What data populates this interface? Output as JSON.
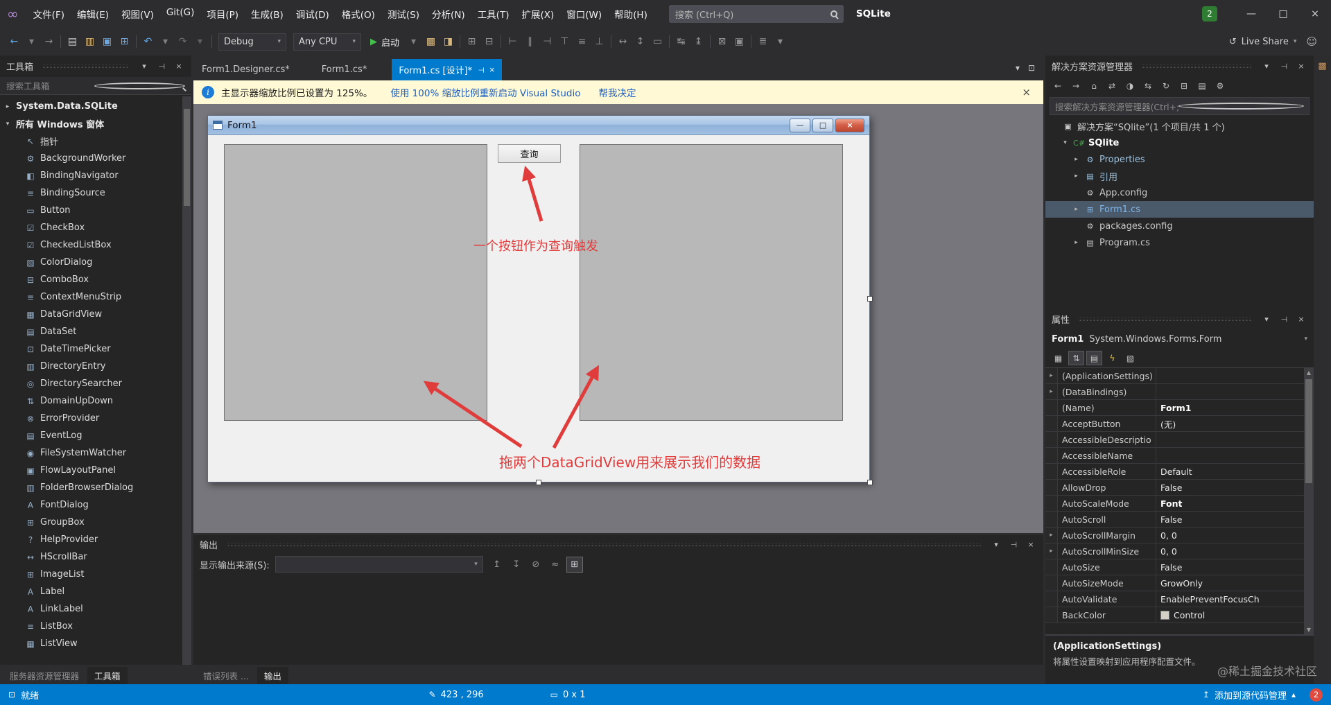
{
  "icons": {
    "caret": "▾",
    "pin": "⊤",
    "close": "×",
    "small_caret": "▴"
  },
  "window": {
    "logo": "∞",
    "badge": "2",
    "solution_title": "SQLite",
    "minimize": "—",
    "maximize": "□",
    "close": "×"
  },
  "menubar": [
    "文件(F)",
    "编辑(E)",
    "视图(V)",
    "Git(G)",
    "项目(P)",
    "生成(B)",
    "调试(D)",
    "格式(O)",
    "测试(S)",
    "分析(N)",
    "工具(T)",
    "扩展(X)",
    "窗口(W)",
    "帮助(H)"
  ],
  "search": {
    "placeholder": "搜索 (Ctrl+Q)"
  },
  "toolbar": {
    "left_icons": [
      {
        "name": "back-icon",
        "glyph": "←",
        "color": "#5fa8ea"
      },
      {
        "name": "back-caret-icon",
        "glyph": "▾",
        "color": "#7f7f7f"
      },
      {
        "name": "forward-icon",
        "glyph": "→",
        "color": "#8b8b8b"
      },
      {
        "name": "toolbar-separator",
        "glyph": "",
        "sep": true
      },
      {
        "name": "new-file-icon",
        "glyph": "▤",
        "color": "#c9c9c9"
      },
      {
        "name": "open-folder-icon",
        "glyph": "▥",
        "color": "#d9b97c"
      },
      {
        "name": "save-icon",
        "glyph": "▣",
        "color": "#6ea8e0"
      },
      {
        "name": "save-all-icon",
        "glyph": "⊞",
        "color": "#6ea8e0"
      },
      {
        "name": "toolbar-separator",
        "glyph": "",
        "sep": true
      },
      {
        "name": "undo-icon",
        "glyph": "↶",
        "color": "#5fa8ea"
      },
      {
        "name": "undo-caret-icon",
        "glyph": "▾",
        "color": "#7f7f7f"
      },
      {
        "name": "redo-icon",
        "glyph": "↷",
        "color": "#6f6f6f"
      },
      {
        "name": "redo-caret-icon",
        "glyph": "▾",
        "color": "#5f5f5f"
      },
      {
        "name": "toolbar-separator",
        "glyph": "",
        "sep": true
      }
    ],
    "debug_target": "Debug",
    "platform": "Any CPU",
    "start_label": "启动",
    "play_glyph": "▶",
    "right_icons": [
      {
        "name": "start-caret-icon",
        "glyph": "▾",
        "color": "#7f7f7f"
      },
      {
        "name": "attach-icon",
        "glyph": "▩",
        "color": "#d9b97c"
      },
      {
        "name": "screenshot-icon",
        "glyph": "◨",
        "color": "#d9b97c"
      },
      {
        "name": "toolbar-separator",
        "glyph": "",
        "sep": true
      },
      {
        "name": "show-grid-icon",
        "glyph": "⊞",
        "color": "#8f8f8f"
      },
      {
        "name": "align-to-grid-icon",
        "glyph": "⊟",
        "color": "#8f8f8f"
      },
      {
        "name": "toolbar-separator",
        "glyph": "",
        "sep": true
      },
      {
        "name": "align-lefts-icon",
        "glyph": "⊢",
        "color": "#8f8f8f"
      },
      {
        "name": "align-centers-icon",
        "glyph": "∥",
        "color": "#8f8f8f"
      },
      {
        "name": "align-rights-icon",
        "glyph": "⊣",
        "color": "#8f8f8f"
      },
      {
        "name": "align-tops-icon",
        "glyph": "⊤",
        "color": "#8f8f8f"
      },
      {
        "name": "align-middles-icon",
        "glyph": "≡",
        "color": "#8f8f8f"
      },
      {
        "name": "align-bottoms-icon",
        "glyph": "⊥",
        "color": "#8f8f8f"
      },
      {
        "name": "toolbar-separator",
        "glyph": "",
        "sep": true
      },
      {
        "name": "same-width-icon",
        "glyph": "↔",
        "color": "#8f8f8f"
      },
      {
        "name": "same-height-icon",
        "glyph": "↕",
        "color": "#8f8f8f"
      },
      {
        "name": "same-size-icon",
        "glyph": "▭",
        "color": "#8f8f8f"
      },
      {
        "name": "toolbar-separator",
        "glyph": "",
        "sep": true
      },
      {
        "name": "horizontal-spacing-icon",
        "glyph": "↹",
        "color": "#8f8f8f"
      },
      {
        "name": "vertical-spacing-icon",
        "glyph": "↨",
        "color": "#8f8f8f"
      },
      {
        "name": "toolbar-separator",
        "glyph": "",
        "sep": true
      },
      {
        "name": "bring-to-front-icon",
        "glyph": "⊠",
        "color": "#8f8f8f"
      },
      {
        "name": "send-to-back-icon",
        "glyph": "▣",
        "color": "#8f8f8f"
      },
      {
        "name": "toolbar-separator",
        "glyph": "",
        "sep": true
      },
      {
        "name": "tab-order-icon",
        "glyph": "≣",
        "color": "#8f8f8f"
      },
      {
        "name": "toolbar-options-icon",
        "glyph": "▾",
        "color": "#8f8f8f"
      }
    ],
    "live_share": {
      "label": "Live Share",
      "glyph": "↺"
    },
    "feedback_glyph": "☺"
  },
  "toolbox": {
    "title": "工具箱",
    "search_placeholder": "搜索工具箱",
    "rows": [
      {
        "label": "System.Data.SQLite",
        "exp": "▸",
        "group": true
      },
      {
        "label": "所有 Windows 窗体",
        "exp": "▾",
        "group": true
      },
      {
        "label": "指针",
        "glyph": "↖",
        "exp": ""
      },
      {
        "label": "BackgroundWorker",
        "glyph": "⚙",
        "exp": ""
      },
      {
        "label": "BindingNavigator",
        "glyph": "◧",
        "exp": ""
      },
      {
        "label": "BindingSource",
        "glyph": "≡",
        "exp": ""
      },
      {
        "label": "Button",
        "glyph": "▭",
        "exp": ""
      },
      {
        "label": "CheckBox",
        "glyph": "☑",
        "exp": ""
      },
      {
        "label": "CheckedListBox",
        "glyph": "☑",
        "exp": ""
      },
      {
        "label": "ColorDialog",
        "glyph": "▨",
        "exp": ""
      },
      {
        "label": "ComboBox",
        "glyph": "⊟",
        "exp": ""
      },
      {
        "label": "ContextMenuStrip",
        "glyph": "≡",
        "exp": ""
      },
      {
        "label": "DataGridView",
        "glyph": "▦",
        "exp": ""
      },
      {
        "label": "DataSet",
        "glyph": "▤",
        "exp": ""
      },
      {
        "label": "DateTimePicker",
        "glyph": "⊡",
        "exp": ""
      },
      {
        "label": "DirectoryEntry",
        "glyph": "▥",
        "exp": ""
      },
      {
        "label": "DirectorySearcher",
        "glyph": "◎",
        "exp": ""
      },
      {
        "label": "DomainUpDown",
        "glyph": "⇅",
        "exp": ""
      },
      {
        "label": "ErrorProvider",
        "glyph": "⊗",
        "exp": ""
      },
      {
        "label": "EventLog",
        "glyph": "▤",
        "exp": ""
      },
      {
        "label": "FileSystemWatcher",
        "glyph": "◉",
        "exp": ""
      },
      {
        "label": "FlowLayoutPanel",
        "glyph": "▣",
        "exp": ""
      },
      {
        "label": "FolderBrowserDialog",
        "glyph": "▥",
        "exp": ""
      },
      {
        "label": "FontDialog",
        "glyph": "A",
        "exp": ""
      },
      {
        "label": "GroupBox",
        "glyph": "⊞",
        "exp": ""
      },
      {
        "label": "HelpProvider",
        "glyph": "?",
        "exp": ""
      },
      {
        "label": "HScrollBar",
        "glyph": "↔",
        "exp": ""
      },
      {
        "label": "ImageList",
        "glyph": "⊞",
        "exp": ""
      },
      {
        "label": "Label",
        "glyph": "A",
        "exp": ""
      },
      {
        "label": "LinkLabel",
        "glyph": "A",
        "exp": ""
      },
      {
        "label": "ListBox",
        "glyph": "≡",
        "exp": ""
      },
      {
        "label": "ListView",
        "glyph": "▦",
        "exp": ""
      }
    ],
    "bottom_tabs": [
      {
        "label": "服务器资源管理器"
      },
      {
        "label": "工具箱",
        "active": true
      }
    ]
  },
  "editor": {
    "tabs": [
      {
        "label": "Form1.Designer.cs*"
      },
      {
        "label": "Form1.cs*"
      },
      {
        "label": "Form1.cs [设计]*",
        "active": true
      }
    ],
    "tabstrip_icons": [
      {
        "name": "active-files-caret-icon",
        "glyph": "▾"
      },
      {
        "name": "window-layout-icon",
        "glyph": "⊡"
      }
    ],
    "infobar": {
      "message": "主显示器缩放比例已设置为 125%。",
      "link1": "使用 100% 缩放比例重新启动 Visual Studio",
      "link2": "帮我决定"
    },
    "form": {
      "title": "Form1",
      "query_button": "查询",
      "annotation_button": "一个按钮作为查询触发",
      "annotation_grids": "拖两个DataGridView用来展示我们的数据"
    }
  },
  "output": {
    "title": "输出",
    "source_label": "显示输出来源(S):",
    "source_value": "",
    "icons": [
      {
        "name": "jump-previous-icon",
        "glyph": "↥"
      },
      {
        "name": "jump-next-icon",
        "glyph": "↧"
      },
      {
        "name": "clear-all-icon",
        "glyph": "⊘"
      },
      {
        "name": "word-wrap-icon",
        "glyph": "≈"
      },
      {
        "name": "auto-scroll-icon",
        "glyph": "⊞",
        "boxed": true
      }
    ],
    "bottom_tabs": [
      {
        "label": "错误列表 ..."
      },
      {
        "label": "输出",
        "active": true
      }
    ]
  },
  "solution_explorer": {
    "title": "解决方案资源管理器",
    "search_placeholder": "搜索解决方案资源管理器(Ctrl+;)",
    "toolbar_icons": [
      {
        "name": "back-icon",
        "glyph": "←"
      },
      {
        "name": "forward-icon",
        "glyph": "→"
      },
      {
        "name": "home-icon",
        "glyph": "⌂"
      },
      {
        "name": "switch-views-icon",
        "glyph": "⇄"
      },
      {
        "name": "pending-changes-icon",
        "glyph": "◑"
      },
      {
        "name": "sync-active-document-icon",
        "glyph": "⇆"
      },
      {
        "name": "refresh-icon",
        "glyph": "↻"
      },
      {
        "name": "collapse-all-icon",
        "glyph": "⊟"
      },
      {
        "name": "show-all-files-icon",
        "glyph": "▤"
      },
      {
        "name": "properties-icon",
        "glyph": "⚙"
      }
    ],
    "tree": [
      {
        "label": "解决方案“SQlite”(1 个项目/共 1 个)",
        "glyph": "▣",
        "color": "#c8c8c8",
        "indent": 0,
        "exp": ""
      },
      {
        "label": "SQlite",
        "glyph": "C#",
        "color": "#46a84c",
        "indent": 1,
        "exp": "▾",
        "bold": true
      },
      {
        "label": "Properties",
        "glyph": "⚙",
        "color": "#9cc3e0",
        "indent": 2,
        "exp": "▸"
      },
      {
        "label": "引用",
        "glyph": "▤",
        "color": "#9cc3e0",
        "indent": 2,
        "exp": "▸"
      },
      {
        "label": "App.config",
        "glyph": "⚙",
        "color": "#c8c8c8",
        "indent": 2,
        "exp": ""
      },
      {
        "label": "Form1.cs",
        "glyph": "⊞",
        "color": "#7eb5e8",
        "indent": 2,
        "exp": "▸",
        "selected": true
      },
      {
        "label": "packages.config",
        "glyph": "⚙",
        "color": "#c8c8c8",
        "indent": 2,
        "exp": ""
      },
      {
        "label": "Program.cs",
        "glyph": "▤",
        "color": "#c8c8c8",
        "indent": 2,
        "exp": "▸"
      }
    ]
  },
  "properties": {
    "title": "属性",
    "object_name": "Form1",
    "object_type": "System.Windows.Forms.Form",
    "toolbar_icons": [
      {
        "name": "categorized-icon",
        "glyph": "▦"
      },
      {
        "name": "alphabetical-icon",
        "glyph": "⇅",
        "selected": true
      },
      {
        "name": "properties-view-icon",
        "glyph": "▤",
        "selected": true
      },
      {
        "name": "events-icon",
        "glyph": "ϟ",
        "color": "#e8c84a"
      },
      {
        "name": "property-pages-icon",
        "glyph": "▧"
      }
    ],
    "rows": [
      {
        "name": "(ApplicationSettings)",
        "value": "",
        "expandable": true
      },
      {
        "name": "(DataBindings)",
        "value": "",
        "expandable": true
      },
      {
        "name": "(Name)",
        "value": "Form1",
        "bold": true
      },
      {
        "name": "AcceptButton",
        "value": "(无)"
      },
      {
        "name": "AccessibleDescriptio",
        "value": ""
      },
      {
        "name": "AccessibleName",
        "value": ""
      },
      {
        "name": "AccessibleRole",
        "value": "Default"
      },
      {
        "name": "AllowDrop",
        "value": "False"
      },
      {
        "name": "AutoScaleMode",
        "value": "Font",
        "bold": true
      },
      {
        "name": "AutoScroll",
        "value": "False"
      },
      {
        "name": "AutoScrollMargin",
        "value": "0, 0",
        "expandable": true
      },
      {
        "name": "AutoScrollMinSize",
        "value": "0, 0",
        "expandable": true
      },
      {
        "name": "AutoSize",
        "value": "False"
      },
      {
        "name": "AutoSizeMode",
        "value": "GrowOnly"
      },
      {
        "name": "AutoValidate",
        "value": "EnablePreventFocusCh"
      },
      {
        "name": "BackColor",
        "value": "Control",
        "swatch": true
      }
    ],
    "description_title": "(ApplicationSettings)",
    "description_text": "将属性设置映射到应用程序配置文件。",
    "swatch_color": "#d4d0c8"
  },
  "right_strip": {
    "icon_glyph": "▩"
  },
  "watermark": "@稀土掘金技术社区",
  "statusbar": {
    "ready": "就绪",
    "position": "423 , 296",
    "size": "0 x 1",
    "source_control": "添加到源代码管理",
    "badge": "2"
  }
}
